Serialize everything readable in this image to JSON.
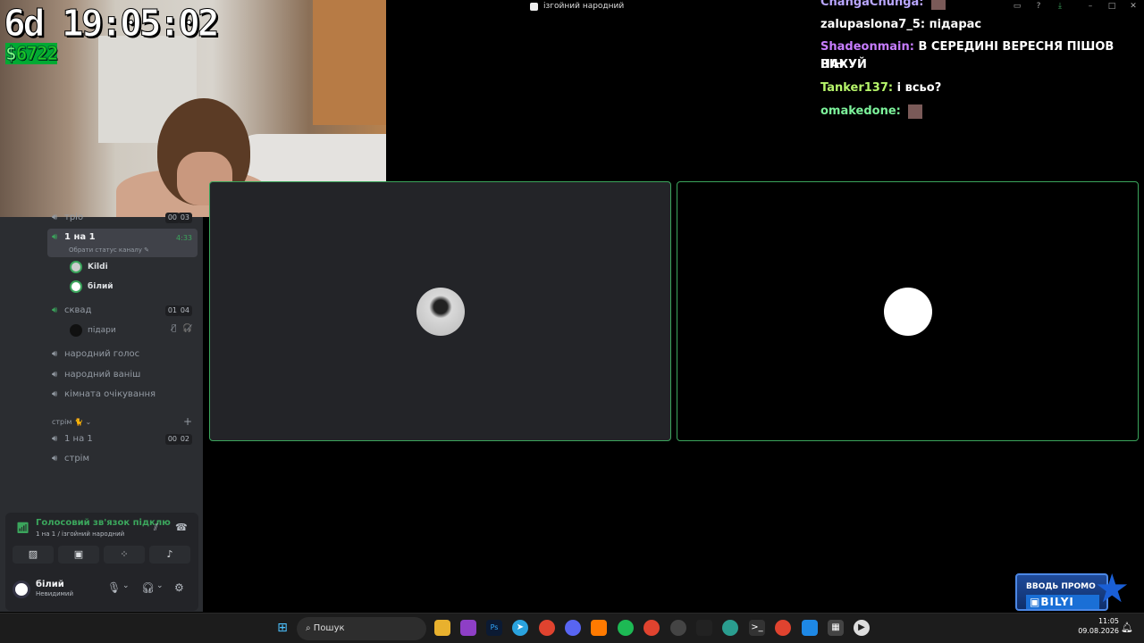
{
  "window": {
    "title": "ізгойний народний"
  },
  "overlay": {
    "timer": "6d 19:05:02",
    "money_symbol": "$",
    "money_value": "6722"
  },
  "sidebar": {
    "channels": [
      {
        "name": "тріо",
        "counts": [
          "00",
          "03"
        ]
      },
      {
        "name": "1 на 1",
        "timer": "4:33",
        "status_hint": "Обрати статус каналу",
        "users": [
          "Kildi",
          "білий"
        ]
      },
      {
        "name": "сквад",
        "counts": [
          "01",
          "04"
        ],
        "users": [
          "підари"
        ]
      },
      {
        "name": "народний голос"
      },
      {
        "name": "народний ваніш"
      },
      {
        "name": "кімната очікування"
      }
    ],
    "category": "стрім 🐈",
    "category_channels": [
      {
        "name": "1 на 1",
        "counts": [
          "00",
          "02"
        ]
      },
      {
        "name": "стрім"
      }
    ]
  },
  "voice_panel": {
    "status": "Голосовий зв'язок підклю",
    "location": "1 на 1 / ізгойний народний"
  },
  "user_panel": {
    "name": "білий",
    "status": "Невидимий"
  },
  "chat": [
    {
      "user": "ChangaChunga:",
      "color": "#b9a6ff",
      "text": "",
      "emote": true
    },
    {
      "user": "zalupaslona7_5:",
      "color": "#ffffff",
      "text": "підарас",
      "emote": false
    },
    {
      "user": "Shadeonmain:",
      "color": "#c77dff",
      "text": "В СЕРЕДИНІ ВЕРЕСНЯ ПІШОВ ВІН",
      "text2": "НАХУЙ",
      "emote": false
    },
    {
      "user": "Tanker137:",
      "color": "#b6f56a",
      "text": "і всьо?",
      "emote": false
    },
    {
      "user": "omakedone:",
      "color": "#7cf29a",
      "text": "",
      "emote": true
    }
  ],
  "promo": {
    "line1": "ВВОДЬ ПРОМО",
    "line2": "BILYI"
  },
  "taskbar": {
    "search_placeholder": "Пошук",
    "time": "11:05",
    "date": "09.08.2026"
  }
}
